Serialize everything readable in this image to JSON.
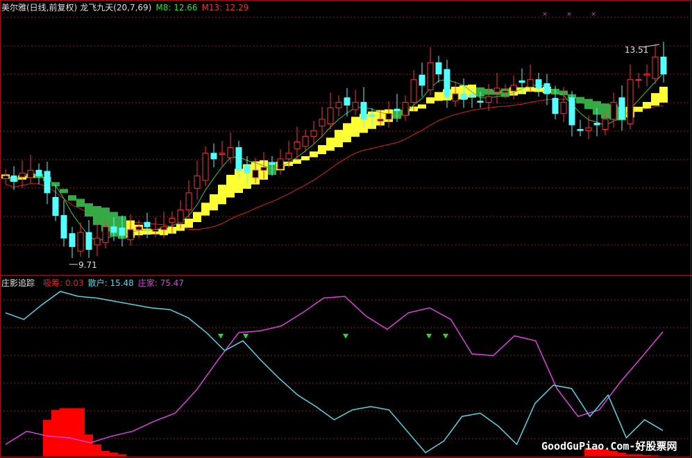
{
  "header": {
    "stock_title": "美尔雅(日线,前复权)",
    "indicator_name": "龙飞九天(20,7,69)",
    "m8_label": "M8: 12.66",
    "m13_label": "M13: 12.29"
  },
  "lower_header": {
    "indicator_name": "庄影追踪",
    "xichou_label": "吸筹: 0.03",
    "sanhu_label": "散户: 15.48",
    "zhuangjia_label": "庄家: 75.47"
  },
  "annotations": {
    "high_label": "13.51",
    "low_label": "9.71"
  },
  "watermark": "GoodGuPiao.Com-好股票网",
  "colors": {
    "up": "#ff3232",
    "down": "#54ffff",
    "rise_band": "#ffff33",
    "fall_band": "#33aa44",
    "m8": "#33cc33",
    "ma_red": "#dd2020",
    "sanhu": "#4fd8e8",
    "zhuangjia": "#e040e0",
    "xichou": "#ff0000",
    "grid": "#a01010"
  },
  "chart_data": [
    {
      "type": "candlestick",
      "title": "美尔雅(日线,前复权) 龙飞九天(20,7,69)",
      "price_range": [
        9.6,
        13.9
      ],
      "high": 13.51,
      "low": 9.71,
      "closes": [
        11.2,
        11.1,
        11.25,
        11.3,
        11.2,
        10.9,
        10.5,
        10.1,
        9.95,
        10.2,
        9.9,
        10.1,
        10.3,
        10.2,
        10.15,
        10.25,
        10.3,
        10.3,
        10.25,
        10.3,
        10.45,
        10.6,
        10.9,
        11.2,
        11.6,
        11.5,
        11.6,
        11.7,
        11.3,
        11.25,
        11.3,
        11.35,
        11.4,
        11.5,
        11.6,
        11.8,
        11.9,
        12.0,
        12.2,
        12.4,
        12.5,
        12.45,
        12.5,
        12.2,
        12.25,
        12.2,
        12.3,
        12.35,
        12.5,
        12.9,
        12.8,
        13.2,
        13.0,
        12.6,
        12.65,
        12.55,
        12.6,
        12.5,
        12.6,
        12.75,
        12.7,
        12.8,
        12.85,
        12.9,
        12.75,
        12.65,
        12.3,
        12.5,
        12.1,
        12.0,
        12.05,
        12.1,
        12.2,
        12.5,
        12.2,
        12.9,
        12.9,
        13.0,
        13.3,
        13.0
      ]
    },
    {
      "type": "line",
      "title": "庄影追踪",
      "ylim": [
        0,
        100
      ],
      "series": [
        {
          "name": "散户",
          "values": [
            87,
            83,
            92,
            100,
            97,
            96,
            94,
            92,
            90,
            89,
            84,
            75,
            64,
            70,
            58,
            47,
            37,
            30,
            22,
            28,
            30,
            28,
            15,
            2,
            9,
            24,
            26,
            18,
            7,
            32,
            43,
            41,
            24,
            37,
            11,
            22,
            15.48
          ]
        },
        {
          "name": "庄家",
          "values": [
            7,
            15,
            12,
            11,
            8,
            12,
            15,
            21,
            26,
            40,
            58,
            75,
            76,
            79,
            87,
            96,
            97,
            85,
            77,
            87,
            90,
            83,
            62,
            61,
            73,
            70,
            41,
            24,
            28,
            45,
            60,
            75.47
          ]
        },
        {
          "name": "吸筹",
          "type": "bar",
          "values": [
            0,
            0,
            0,
            0,
            0,
            22,
            28,
            29,
            29,
            29,
            13,
            7,
            3,
            2,
            1,
            0,
            0,
            0,
            0,
            0,
            0,
            0,
            0,
            0,
            0,
            0,
            0,
            0,
            0,
            0,
            0,
            0,
            0,
            0,
            0,
            0,
            0,
            0,
            0,
            0,
            0,
            0,
            0,
            0,
            0,
            0,
            0,
            0,
            0,
            0,
            0,
            0,
            0,
            0,
            0,
            0,
            0,
            0,
            0,
            0,
            0,
            0,
            0,
            0,
            0,
            0,
            0,
            0,
            0,
            0,
            5,
            5,
            4,
            3,
            2,
            1,
            1,
            0.5,
            0.3,
            0.03
          ]
        }
      ],
      "signals_at_candle": [
        25,
        28,
        40,
        50,
        52
      ]
    }
  ]
}
